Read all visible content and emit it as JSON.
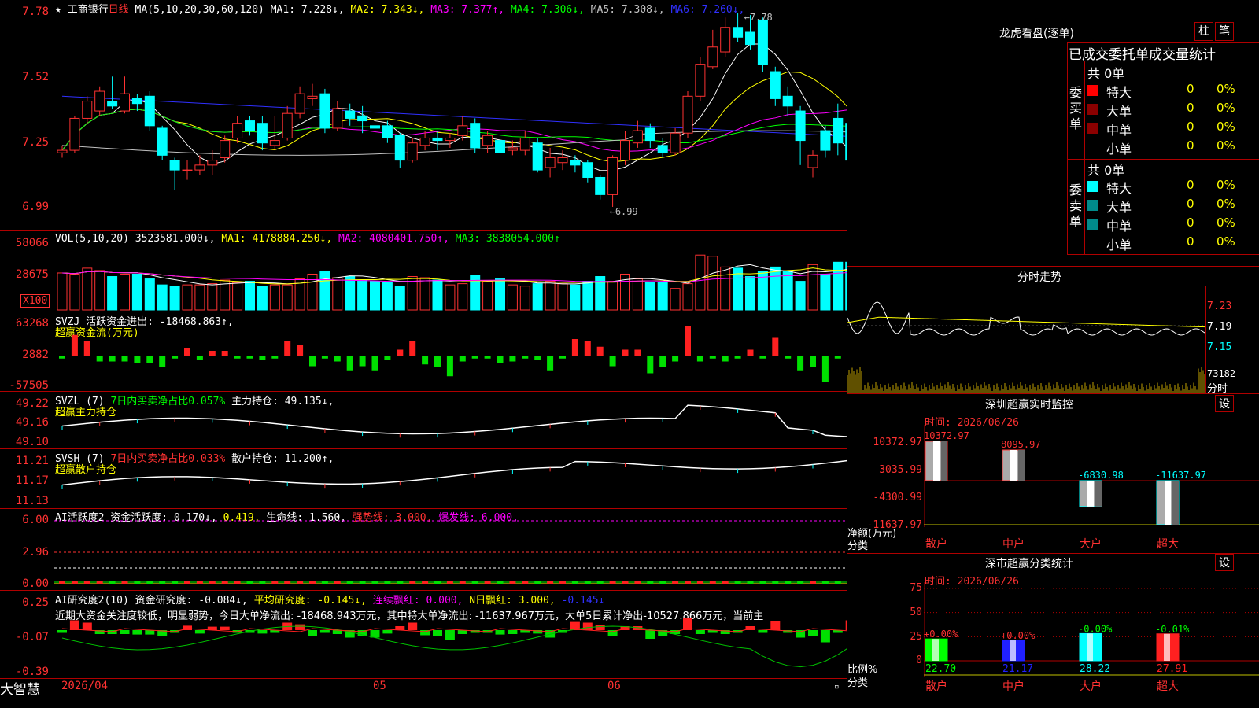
{
  "stock": {
    "name": "工商银行",
    "period": "日线",
    "ma_def": "MA(5,10,20,30,60,120)"
  },
  "main_info": [
    {
      "label": "MA1: ",
      "value": "7.228",
      "arrow": "↓",
      "color": "#ffffff"
    },
    {
      "label": "MA2: ",
      "value": "7.343",
      "arrow": "↓",
      "color": "#ffff00"
    },
    {
      "label": "MA3: ",
      "value": "7.377",
      "arrow": "↑",
      "color": "#ff00ff"
    },
    {
      "label": "MA4: ",
      "value": "7.306",
      "arrow": "↓",
      "color": "#00ff00"
    },
    {
      "label": "MA5: ",
      "value": "7.308",
      "arrow": "↓",
      "color": "#c0c0c0"
    },
    {
      "label": "MA6: ",
      "value": "7.260",
      "arrow": "↓",
      "color": "#3030ff"
    }
  ],
  "price_axis": [
    "7.78",
    "7.52",
    "7.25",
    "6.99"
  ],
  "price_marks": {
    "high": "7.78",
    "low": "6.99"
  },
  "vol": {
    "axis": [
      "58066",
      "28675"
    ],
    "unit": "X100",
    "title": "VOL(5,10,20)",
    "value": "3523581.000",
    "arrow": "↓",
    "ma1": "MA1: 4178884.250↓,",
    "ma2": "MA2: 4080401.750↑,",
    "ma3": "MA3: 3838054.000↑"
  },
  "svzj": {
    "axis": [
      "63268",
      "2882",
      "-57505"
    ],
    "title": "SVZJ  活跃资金进出: -18468.863↑,",
    "sub": "超赢资金流(万元)"
  },
  "svzl": {
    "axis": [
      "49.22",
      "49.16",
      "49.10"
    ],
    "title": "SVZL (7)",
    "pct": "7日内买卖净占比0.057%",
    "hold": "主力持仓: 49.135↓,",
    "sub": "超赢主力持仓"
  },
  "svsh": {
    "axis": [
      "11.21",
      "11.17",
      "11.13"
    ],
    "title": "SVSH (7)",
    "pct": "7日内买卖净占比0.033%",
    "hold": "散户持仓: 11.200↑,",
    "sub": "超赢散户持仓"
  },
  "ai_act": {
    "axis": [
      "6.00",
      "2.96",
      "0.00"
    ],
    "title": "AI活跃度2 资金活跃度: 0.170↓,",
    "v2": "0.419,",
    "life": "生命线: 1.560,",
    "strong": "强势线: 3.000,",
    "burst": "爆发线: 6.000,"
  },
  "ai_res": {
    "axis": [
      "0.25",
      "-0.07",
      "-0.39"
    ],
    "title": "AI研究度2(10) 资金研究度: -0.084↓,",
    "avg": "平均研究度: -0.145↓,",
    "cont": "连续飘红: 0.000,",
    "nred": "N日飘红: 3.000,",
    "last": "-0.145↓",
    "comment": "近期大资金关注度较低，明显弱势，今日大单净流出: -18468.943万元，其中特大单净流出: -11637.967万元，大单5日累计净出-10527.866万元，当前主"
  },
  "date_axis": {
    "d1": "2026/04",
    "d2": "05",
    "d3": "06"
  },
  "brand": "大智慧",
  "lhb": {
    "title": "龙虎看盘(逐单)",
    "btn1": "柱",
    "btn2": "笔",
    "header": "已成交委托单成交量统计",
    "buy_label": "委买单",
    "sell_label": "委卖单",
    "buy_total": "共 0单",
    "sell_total": "共 0单",
    "rows": [
      {
        "name": "特大",
        "qty": "0",
        "pct": "0%",
        "buy_color": "#ff0000",
        "sell_color": "#00ffff"
      },
      {
        "name": "大单",
        "qty": "0",
        "pct": "0%",
        "buy_color": "#8b0000",
        "sell_color": "#008b8b"
      },
      {
        "name": "中单",
        "qty": "0",
        "pct": "0%",
        "buy_color": "#8b0000",
        "sell_color": "#008b8b"
      },
      {
        "name": "小单",
        "qty": "0",
        "pct": "0%",
        "buy_color": "#000000",
        "sell_color": "#000000"
      }
    ]
  },
  "tick": {
    "title": "分时走势",
    "axis": [
      "7.23",
      "7.19",
      "7.15"
    ],
    "vol_label": "73182",
    "vol_unit": "分时"
  },
  "sz_monitor": {
    "title": "深圳超赢实时监控",
    "btn": "设",
    "time": "时间: 2026/06/26",
    "axis": [
      "10372.97",
      "3035.99",
      "-4300.99",
      "-11637.97"
    ],
    "unit": "净额(万元)",
    "cat_label": "分类",
    "bars": [
      {
        "name": "散户",
        "value": 10372.97,
        "label": "10372.97"
      },
      {
        "name": "中户",
        "value": 8095.97,
        "label": "8095.97"
      },
      {
        "name": "大户",
        "value": -6830.98,
        "label": "-6830.98"
      },
      {
        "name": "超大",
        "value": -11637.97,
        "label": "-11637.97"
      }
    ]
  },
  "sz_class": {
    "title": "深市超赢分类统计",
    "btn": "设",
    "time": "时间: 2026/06/26",
    "axis": [
      "75",
      "50",
      "25",
      "0"
    ],
    "unit": "比例%",
    "cat_label": "分类",
    "bars": [
      {
        "name": "散户",
        "ratio": 22.7,
        "label": "22.70",
        "chg": "+0.00%",
        "color": "#00ff00"
      },
      {
        "name": "中户",
        "ratio": 21.17,
        "label": "21.17",
        "chg": "+0.00%",
        "color": "#2020ff"
      },
      {
        "name": "大户",
        "ratio": 28.22,
        "label": "28.22",
        "chg": "-0.00%",
        "color": "#00ffff"
      },
      {
        "name": "超大",
        "ratio": 27.91,
        "label": "27.91",
        "chg": "-0.01%",
        "color": "#ff2020"
      }
    ]
  },
  "candles": [
    [
      7.21,
      7.22,
      7.24,
      7.19
    ],
    [
      7.22,
      7.35,
      7.36,
      7.21
    ],
    [
      7.35,
      7.42,
      7.44,
      7.33
    ],
    [
      7.38,
      7.46,
      7.48,
      7.36
    ],
    [
      7.42,
      7.4,
      7.52,
      7.39
    ],
    [
      7.38,
      7.45,
      7.52,
      7.37
    ],
    [
      7.43,
      7.41,
      7.45,
      7.38
    ],
    [
      7.44,
      7.32,
      7.46,
      7.3
    ],
    [
      7.31,
      7.2,
      7.32,
      7.18
    ],
    [
      7.18,
      7.14,
      7.19,
      7.06
    ],
    [
      7.14,
      7.14,
      7.18,
      7.1
    ],
    [
      7.14,
      7.16,
      7.2,
      7.12
    ],
    [
      7.16,
      7.18,
      7.22,
      7.12
    ],
    [
      7.19,
      7.26,
      7.28,
      7.17
    ],
    [
      7.27,
      7.33,
      7.36,
      7.25
    ],
    [
      7.34,
      7.3,
      7.36,
      7.28
    ],
    [
      7.33,
      7.25,
      7.36,
      7.22
    ],
    [
      7.24,
      7.26,
      7.36,
      7.22
    ],
    [
      7.27,
      7.37,
      7.4,
      7.26
    ],
    [
      7.37,
      7.45,
      7.48,
      7.35
    ],
    [
      7.43,
      7.44,
      7.49,
      7.4
    ],
    [
      7.45,
      7.31,
      7.47,
      7.29
    ],
    [
      7.31,
      7.39,
      7.42,
      7.3
    ],
    [
      7.38,
      7.35,
      7.41,
      7.32
    ],
    [
      7.36,
      7.34,
      7.4,
      7.29
    ],
    [
      7.32,
      7.31,
      7.34,
      7.28
    ],
    [
      7.32,
      7.27,
      7.34,
      7.25
    ],
    [
      7.28,
      7.18,
      7.29,
      7.15
    ],
    [
      7.18,
      7.25,
      7.27,
      7.17
    ],
    [
      7.24,
      7.27,
      7.3,
      7.22
    ],
    [
      7.27,
      7.26,
      7.3,
      7.22
    ],
    [
      7.26,
      7.27,
      7.29,
      7.23
    ],
    [
      7.28,
      7.32,
      7.36,
      7.26
    ],
    [
      7.33,
      7.23,
      7.35,
      7.21
    ],
    [
      7.24,
      7.28,
      7.3,
      7.21
    ],
    [
      7.26,
      7.21,
      7.28,
      7.18
    ],
    [
      7.22,
      7.23,
      7.26,
      7.2
    ],
    [
      7.22,
      7.27,
      7.3,
      7.2
    ],
    [
      7.25,
      7.14,
      7.27,
      7.13
    ],
    [
      7.15,
      7.19,
      7.23,
      7.11
    ],
    [
      7.17,
      7.19,
      7.22,
      7.14
    ],
    [
      7.18,
      7.16,
      7.2,
      7.13
    ],
    [
      7.17,
      7.11,
      7.18,
      7.09
    ],
    [
      7.11,
      7.04,
      7.12,
      7.02
    ],
    [
      7.04,
      7.19,
      7.2,
      6.99
    ],
    [
      7.18,
      7.26,
      7.3,
      7.16
    ],
    [
      7.25,
      7.3,
      7.34,
      7.23
    ],
    [
      7.31,
      7.26,
      7.33,
      7.23
    ],
    [
      7.24,
      7.21,
      7.27,
      7.19
    ],
    [
      7.21,
      7.29,
      7.31,
      7.2
    ],
    [
      7.29,
      7.44,
      7.46,
      7.27
    ],
    [
      7.44,
      7.57,
      7.6,
      7.42
    ],
    [
      7.56,
      7.64,
      7.71,
      7.55
    ],
    [
      7.62,
      7.72,
      7.76,
      7.6
    ],
    [
      7.72,
      7.68,
      7.78,
      7.66
    ],
    [
      7.7,
      7.65,
      7.77,
      7.63
    ],
    [
      7.75,
      7.57,
      7.76,
      7.54
    ],
    [
      7.54,
      7.43,
      7.56,
      7.4
    ],
    [
      7.44,
      7.4,
      7.48,
      7.36
    ],
    [
      7.38,
      7.26,
      7.4,
      7.16
    ],
    [
      7.15,
      7.2,
      7.22,
      7.11
    ],
    [
      7.3,
      7.22,
      7.32,
      7.19
    ],
    [
      7.35,
      7.25,
      7.41,
      7.2
    ],
    [
      7.33,
      7.18,
      7.4,
      7.16
    ],
    [
      7.18,
      7.23,
      7.26,
      7.17
    ]
  ],
  "volumes": [
    31,
    30,
    35,
    33,
    28,
    30,
    30,
    26,
    21,
    20,
    21,
    21,
    22,
    25,
    23,
    24,
    20,
    21,
    21,
    26,
    30,
    32,
    27,
    28,
    25,
    24,
    23,
    20,
    28,
    27,
    25,
    21,
    22,
    29,
    24,
    26,
    21,
    20,
    22,
    24,
    22,
    21,
    24,
    28,
    24,
    30,
    26,
    23,
    23,
    18,
    22,
    46,
    45,
    36,
    35,
    28,
    32,
    36,
    32,
    24,
    38,
    30,
    40,
    40,
    33,
    33
  ],
  "svzj_values": [
    -5,
    35,
    25,
    -10,
    -10,
    -10,
    -12,
    -12,
    -20,
    -5,
    12,
    -8,
    8,
    8,
    -5,
    -5,
    -8,
    -5,
    25,
    18,
    -18,
    -5,
    -10,
    -25,
    -18,
    -25,
    -8,
    10,
    25,
    -15,
    -20,
    -35,
    -10,
    -5,
    -5,
    -12,
    -10,
    -5,
    -8,
    -25,
    -5,
    28,
    25,
    15,
    -18,
    10,
    10,
    -30,
    -20,
    -10,
    50,
    -10,
    -5,
    -10,
    -5,
    10,
    -5,
    30,
    -5,
    -25,
    -20,
    -45,
    -5,
    35,
    -15,
    -15,
    -15
  ]
}
